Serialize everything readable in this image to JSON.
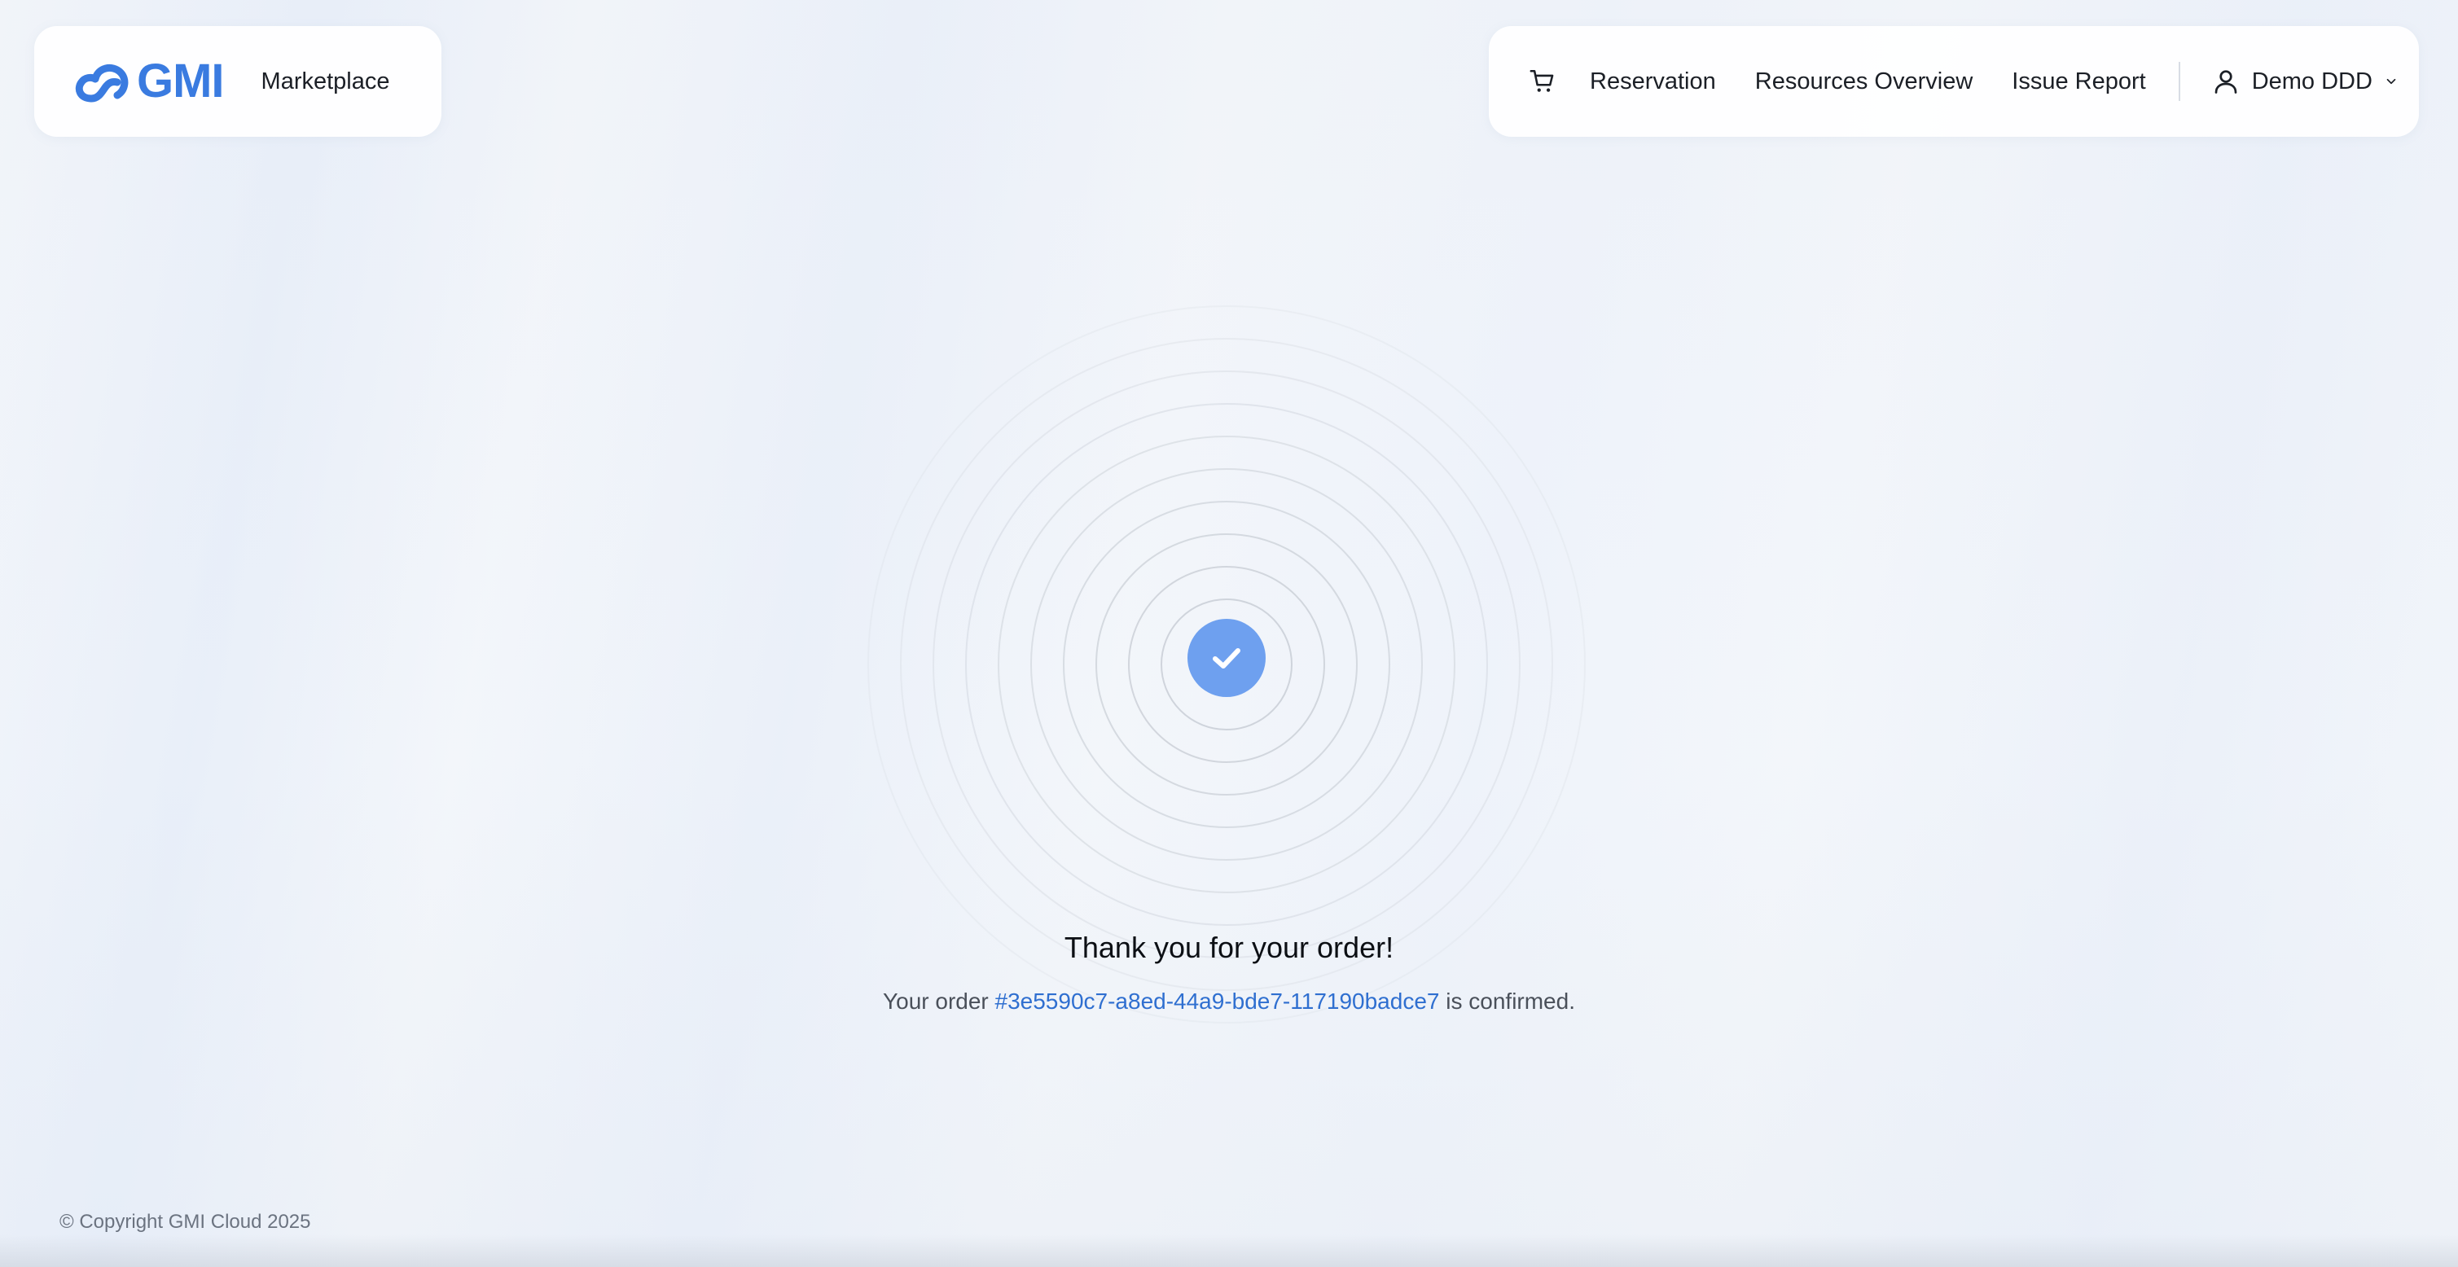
{
  "header": {
    "logo_text": "GMI",
    "marketplace_label": "Marketplace",
    "nav": {
      "reservation": "Reservation",
      "resources_overview": "Resources Overview",
      "issue_report": "Issue Report"
    },
    "user": {
      "name": "Demo DDD"
    }
  },
  "confirmation": {
    "title": "Thank you for your order!",
    "prefix": "Your order ",
    "order_id": "#3e5590c7-a8ed-44a9-bde7-117190badce7",
    "suffix": " is confirmed."
  },
  "footer": {
    "copyright": "© Copyright GMI Cloud 2025"
  },
  "colors": {
    "brand": "#3a7be0",
    "accent": "#6ea0ef",
    "link": "#2f6fd0"
  },
  "icons": {
    "cart": "cart-icon",
    "user": "user-icon",
    "chevron": "chevron-down-icon",
    "success": "check-icon"
  }
}
